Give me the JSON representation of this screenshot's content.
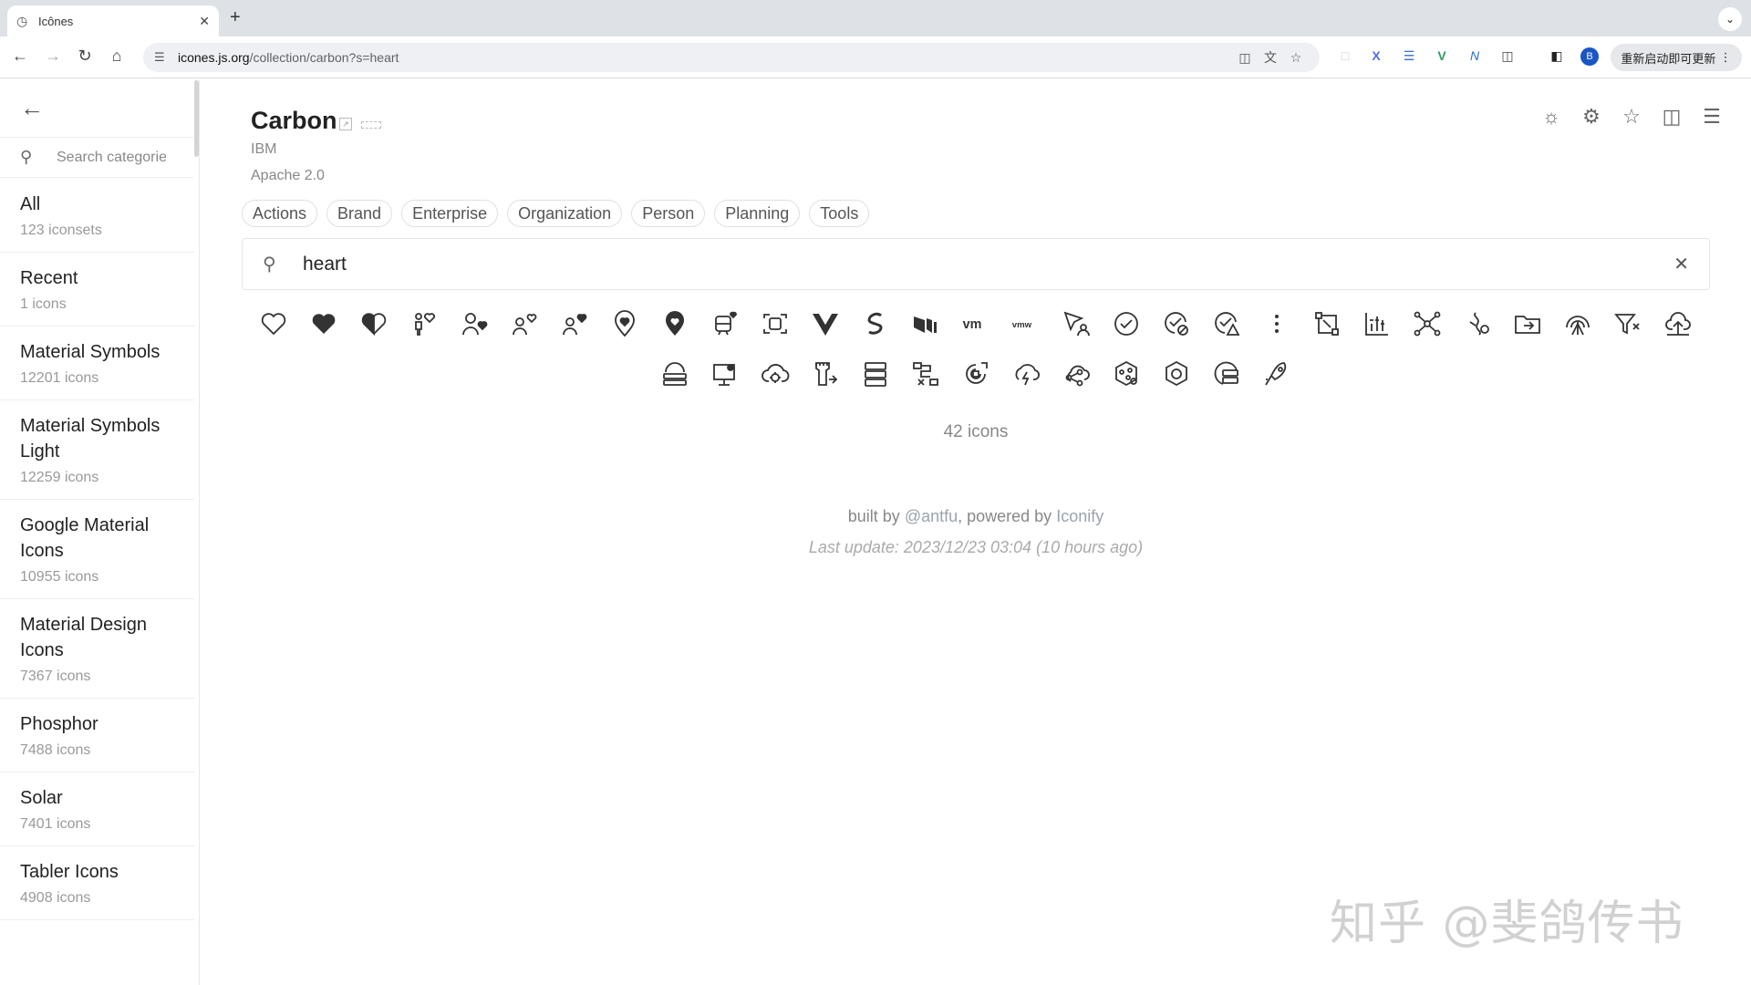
{
  "browser": {
    "tab_title": "Icônes",
    "url_host": "icones.js.org",
    "url_path": "/collection/carbon?s=heart",
    "update_label": "重新启动即可更新",
    "profile_initial": "B"
  },
  "sidebar": {
    "search_placeholder": "Search categories",
    "collections": [
      {
        "name": "All",
        "count": "123 iconsets"
      },
      {
        "name": "Recent",
        "count": "1 icons"
      },
      {
        "name": "Material Symbols",
        "count": "12201 icons"
      },
      {
        "name": "Material Symbols Light",
        "count": "12259 icons"
      },
      {
        "name": "Google Material Icons",
        "count": "10955 icons"
      },
      {
        "name": "Material Design Icons",
        "count": "7367 icons"
      },
      {
        "name": "Phosphor",
        "count": "7488 icons"
      },
      {
        "name": "Solar",
        "count": "7401 icons"
      },
      {
        "name": "Tabler Icons",
        "count": "4908 icons"
      }
    ]
  },
  "header": {
    "title": "Carbon",
    "author": "IBM",
    "license": "Apache 2.0"
  },
  "tags": [
    "Actions",
    "Brand",
    "Enterprise",
    "Organization",
    "Person",
    "Planning",
    "Tools"
  ],
  "search": {
    "value": "heart"
  },
  "results": {
    "icons": [
      "favorite",
      "favorite-filled",
      "favorite-half",
      "person-favorite",
      "user-favorite",
      "user-favorite-alt",
      "user-favorite-alt-filled",
      "location-heart",
      "location-heart-filled",
      "bus-heart",
      "sight-heart",
      "vue",
      "svelte",
      "netlify",
      "vmware-vm",
      "vmware",
      "pointer-heart",
      "checkmark-heart",
      "health-cross-heart",
      "warning-heart",
      "overflow-menu",
      "transform-heart",
      "chart-heart",
      "network-heart",
      "medication-heart",
      "folder-heart",
      "radar-heart",
      "filter-heart",
      "cloud-upload-heart",
      "saas-heart",
      "monitor-settings",
      "cloud-settings",
      "tower-heart",
      "data-base-heart",
      "flow-heart",
      "radar-alt-heart",
      "flash-heart",
      "share-heart",
      "heart-network",
      "hexagon-heart",
      "data-share-heart",
      "rocket-heart"
    ],
    "count_label": "42 icons"
  },
  "footer": {
    "built_by": "built by",
    "author_link": "@antfu",
    "powered_by": ", powered by",
    "iconify_link": "Iconify",
    "last_update": "Last update: 2023/12/23 03:04 (10 hours ago)"
  },
  "watermark": "知乎 @斐鸽传书"
}
